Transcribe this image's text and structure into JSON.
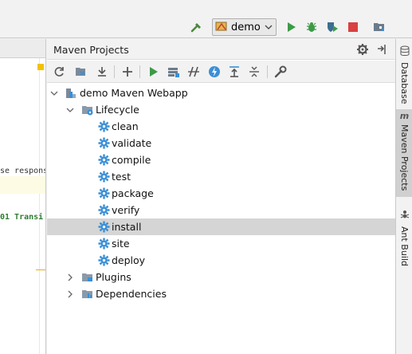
{
  "toolbar": {
    "run_config_label": "demo",
    "icons": [
      "hammer-icon",
      "run-icon",
      "debug-icon",
      "coverage-icon",
      "stop-icon",
      "project-structure-icon"
    ]
  },
  "editor": {
    "line1": "se respons",
    "line2": "01 Transi"
  },
  "maven_panel": {
    "title": "Maven Projects",
    "toolbar_icons": [
      "reimport-icon",
      "generate-sources-icon",
      "download-icon",
      "add-icon",
      "run-goal-icon",
      "execute-goal-icon",
      "toggle-offline-icon",
      "skip-tests-icon",
      "show-dependencies-icon",
      "collapse-all-icon",
      "maven-settings-icon"
    ],
    "tree": {
      "project": "demo Maven Webapp",
      "lifecycle_label": "Lifecycle",
      "goals": [
        "clean",
        "validate",
        "compile",
        "test",
        "package",
        "verify",
        "install",
        "site",
        "deploy"
      ],
      "selected_goal": "install",
      "plugins_label": "Plugins",
      "dependencies_label": "Dependencies"
    }
  },
  "right_strip": {
    "tabs": [
      {
        "label": "Database",
        "icon": "database-icon"
      },
      {
        "label": "Maven Projects",
        "icon": "maven-icon"
      },
      {
        "label": "Ant Build",
        "icon": "ant-icon"
      }
    ]
  },
  "colors": {
    "run_green": "#3d9a47",
    "stop_red": "#d94040",
    "gear_blue": "#3a8fd6",
    "selection": "#d5d5d5"
  }
}
